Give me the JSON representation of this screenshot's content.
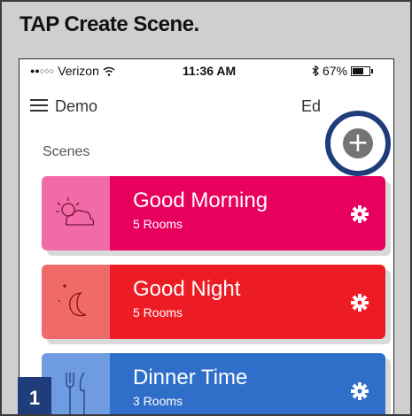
{
  "instruction": "TAP Create Scene.",
  "status_bar": {
    "carrier": "Verizon",
    "time": "11:36 AM",
    "battery": "67%",
    "battery_level": 0.67
  },
  "nav": {
    "menu_icon": "hamburger-menu-icon",
    "home_name": "Demo",
    "edit_label": "Ed",
    "add_icon": "plus-circle-icon"
  },
  "section_title": "Scenes",
  "scenes": [
    {
      "name": "Good Morning",
      "rooms": "5 Rooms",
      "icon": "sun-cloud-icon",
      "color": "#e8005f",
      "icon_color": "#f36ba6"
    },
    {
      "name": "Good Night",
      "rooms": "5 Rooms",
      "icon": "moon-stars-icon",
      "color": "#ed1c24",
      "icon_color": "#f06a6a"
    },
    {
      "name": "Dinner Time",
      "rooms": "3 Rooms",
      "icon": "fork-knife-icon",
      "color": "#2f6fc9",
      "icon_color": "#6f9be0"
    }
  ],
  "step_number": "1",
  "colors": {
    "highlight_ring": "#1f3d7a",
    "step_badge": "#1f3d7a"
  }
}
